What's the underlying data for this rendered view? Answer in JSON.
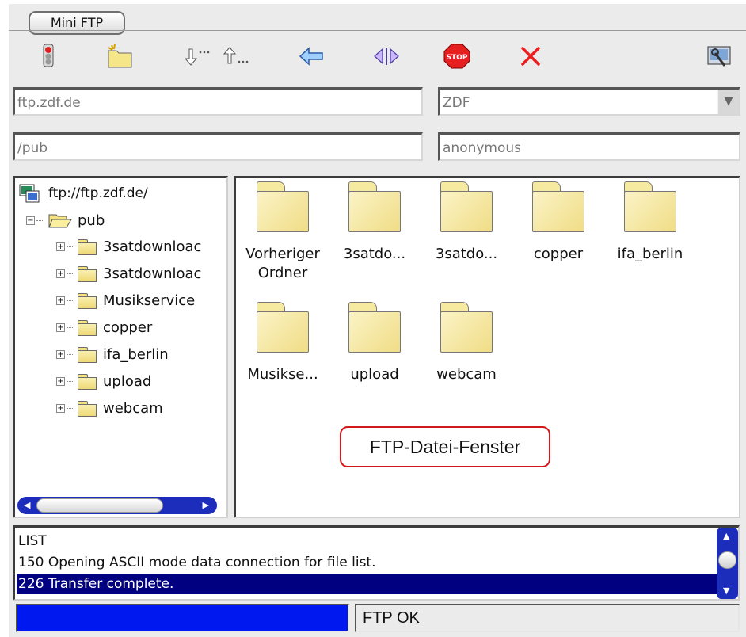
{
  "tab": {
    "label": "Mini FTP"
  },
  "toolbar": {
    "buttons": [
      {
        "name": "connect-icon"
      },
      {
        "name": "new-folder-icon"
      },
      {
        "name": "download-icon"
      },
      {
        "name": "upload-icon"
      },
      {
        "name": "back-arrow-icon"
      },
      {
        "name": "refresh-icon"
      },
      {
        "name": "stop-icon",
        "label": "STOP"
      },
      {
        "name": "delete-icon"
      },
      {
        "name": "settings-icon"
      }
    ]
  },
  "fields": {
    "host": "ftp.zdf.de",
    "profile": "ZDF",
    "path": "/pub",
    "user": "anonymous"
  },
  "tree": {
    "root": "ftp://ftp.zdf.de/",
    "folder": "pub",
    "children": [
      "3satdownloac",
      "3satdownloac",
      "Musikservice",
      "copper",
      "ifa_berlin",
      "upload",
      "webcam"
    ]
  },
  "files": [
    {
      "label": "Vorheriger",
      "label2": "Ordner"
    },
    {
      "label": "3satdo...",
      "label2": ""
    },
    {
      "label": "3satdo...",
      "label2": ""
    },
    {
      "label": "copper",
      "label2": ""
    },
    {
      "label": "ifa_berlin",
      "label2": ""
    },
    {
      "label": "Musikse...",
      "label2": ""
    },
    {
      "label": "upload",
      "label2": ""
    },
    {
      "label": "webcam",
      "label2": ""
    }
  ],
  "callout": {
    "text": "FTP-Datei-Fenster"
  },
  "log": {
    "lines": [
      "LIST",
      "150 Opening ASCII mode data connection for file list.",
      "226 Transfer complete."
    ],
    "selected_index": 2
  },
  "status": {
    "progress": 1.0,
    "text": "FTP OK"
  },
  "colors": {
    "selection": "#000080",
    "progress": "#0018f0",
    "callout_border": "#d21818",
    "scrollbar": "#1c2cbb"
  }
}
